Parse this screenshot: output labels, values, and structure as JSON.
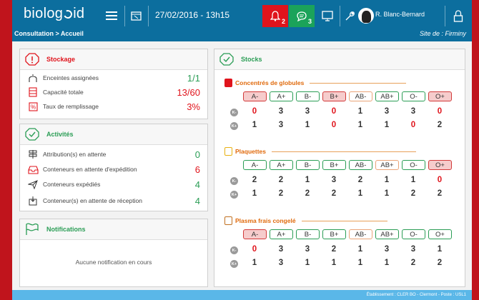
{
  "app": {
    "logo_left": "biolog",
    "logo_right": "id"
  },
  "topbar": {
    "datetime": "27/02/2016 - 13h15",
    "alert_bell_count": "2",
    "alert_chat_count": "3",
    "user_name": "R. Blanc-Bernard"
  },
  "subbar": {
    "breadcrumb": "Consultation > Accueil",
    "site": "Site de : Firminy"
  },
  "stockage": {
    "title": "Stockage",
    "rows": [
      {
        "label": "Enceintes assignées",
        "value": "1/1",
        "color": "#2a9d55"
      },
      {
        "label": "Capacité totale",
        "value": "13/60",
        "color": "#e0141c"
      },
      {
        "label": "Taux de remplissage",
        "value": "3%",
        "color": "#e0141c"
      }
    ]
  },
  "activites": {
    "title": "Activités",
    "rows": [
      {
        "label": "Attribution(s) en attente",
        "value": "0",
        "color": "#2a9d55"
      },
      {
        "label": "Conteneurs en attente d'expédition",
        "value": "6",
        "color": "#e0141c"
      },
      {
        "label": "Conteneurs expédiés",
        "value": "4",
        "color": "#2a9d55"
      },
      {
        "label": "Conteneur(s) en attente de réception",
        "value": "4",
        "color": "#2a9d55"
      }
    ]
  },
  "notifications": {
    "title": "Notifications",
    "empty": "Aucune notification en cours"
  },
  "stocks": {
    "title": "Stocks",
    "kminus": "K-",
    "kplus": "K+",
    "groups": [
      "A-",
      "A+",
      "B-",
      "B+",
      "AB-",
      "AB+",
      "O-",
      "O+"
    ],
    "sections": [
      {
        "title": "Concentrés de globules",
        "group_styles": [
          "red",
          "green",
          "green",
          "red",
          "orange",
          "green",
          "green",
          "red"
        ],
        "kminus": [
          "0",
          "3",
          "3",
          "0",
          "1",
          "3",
          "3",
          "0"
        ],
        "kplus": [
          "1",
          "3",
          "1",
          "0",
          "1",
          "1",
          "0",
          "2"
        ]
      },
      {
        "title": "Plaquettes",
        "group_styles": [
          "green",
          "green",
          "green",
          "green",
          "green",
          "orange",
          "green",
          "red"
        ],
        "kminus": [
          "2",
          "2",
          "1",
          "3",
          "2",
          "1",
          "1",
          "0"
        ],
        "kplus": [
          "1",
          "2",
          "2",
          "2",
          "1",
          "1",
          "2",
          "2"
        ]
      },
      {
        "title": "Plasma frais congelé",
        "group_styles": [
          "red",
          "green",
          "green",
          "green",
          "orange",
          "green",
          "green",
          "green"
        ],
        "kminus": [
          "0",
          "3",
          "3",
          "2",
          "1",
          "3",
          "3",
          "1"
        ],
        "kplus": [
          "1",
          "3",
          "1",
          "1",
          "1",
          "1",
          "2",
          "2"
        ]
      }
    ]
  },
  "footer": {
    "text": "Établissement : CLER BO - Clermont - Poste : USL1"
  },
  "colors": {
    "brand": "#0c6e9e",
    "ok": "#2a9d55",
    "alert": "#e0141c",
    "section": "#e06a0c",
    "frame": "#c0141c"
  }
}
